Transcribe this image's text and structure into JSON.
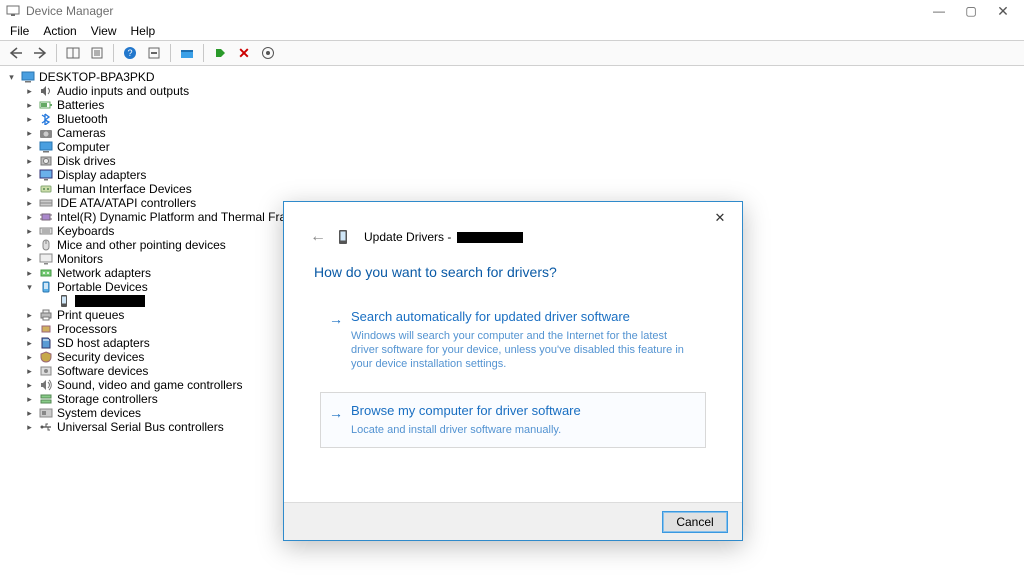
{
  "window": {
    "title": "Device Manager",
    "controls": {
      "min": "—",
      "max": "▢",
      "close": "✕"
    }
  },
  "menu": {
    "file": "File",
    "action": "Action",
    "view": "View",
    "help": "Help"
  },
  "tree": {
    "root": "DESKTOP-BPA3PKD",
    "items": [
      {
        "label": "Audio inputs and outputs",
        "icon": "speaker"
      },
      {
        "label": "Batteries",
        "icon": "battery"
      },
      {
        "label": "Bluetooth",
        "icon": "bluetooth"
      },
      {
        "label": "Cameras",
        "icon": "camera"
      },
      {
        "label": "Computer",
        "icon": "monitor"
      },
      {
        "label": "Disk drives",
        "icon": "disk"
      },
      {
        "label": "Display adapters",
        "icon": "display"
      },
      {
        "label": "Human Interface Devices",
        "icon": "hid"
      },
      {
        "label": "IDE ATA/ATAPI controllers",
        "icon": "ide"
      },
      {
        "label": "Intel(R) Dynamic Platform and Thermal Framework",
        "icon": "chip"
      },
      {
        "label": "Keyboards",
        "icon": "keyboard"
      },
      {
        "label": "Mice and other pointing devices",
        "icon": "mouse"
      },
      {
        "label": "Monitors",
        "icon": "monitor2"
      },
      {
        "label": "Network adapters",
        "icon": "net"
      },
      {
        "label": "Portable Devices",
        "icon": "portable",
        "expanded": true,
        "children": [
          {
            "label": "[redacted]",
            "icon": "phone",
            "redacted": true,
            "selected": true
          }
        ]
      },
      {
        "label": "Print queues",
        "icon": "printer"
      },
      {
        "label": "Processors",
        "icon": "cpu"
      },
      {
        "label": "SD host adapters",
        "icon": "sd"
      },
      {
        "label": "Security devices",
        "icon": "security"
      },
      {
        "label": "Software devices",
        "icon": "software"
      },
      {
        "label": "Sound, video and game controllers",
        "icon": "sound"
      },
      {
        "label": "Storage controllers",
        "icon": "storage"
      },
      {
        "label": "System devices",
        "icon": "system"
      },
      {
        "label": "Universal Serial Bus controllers",
        "icon": "usb"
      }
    ]
  },
  "dialog": {
    "title_prefix": "Update Drivers - ",
    "question": "How do you want to search for drivers?",
    "opt1_title": "Search automatically for updated driver software",
    "opt1_desc": "Windows will search your computer and the Internet for the latest driver software for your device, unless you've disabled this feature in your device installation settings.",
    "opt2_title": "Browse my computer for driver software",
    "opt2_desc": "Locate and install driver software manually.",
    "cancel": "Cancel"
  }
}
